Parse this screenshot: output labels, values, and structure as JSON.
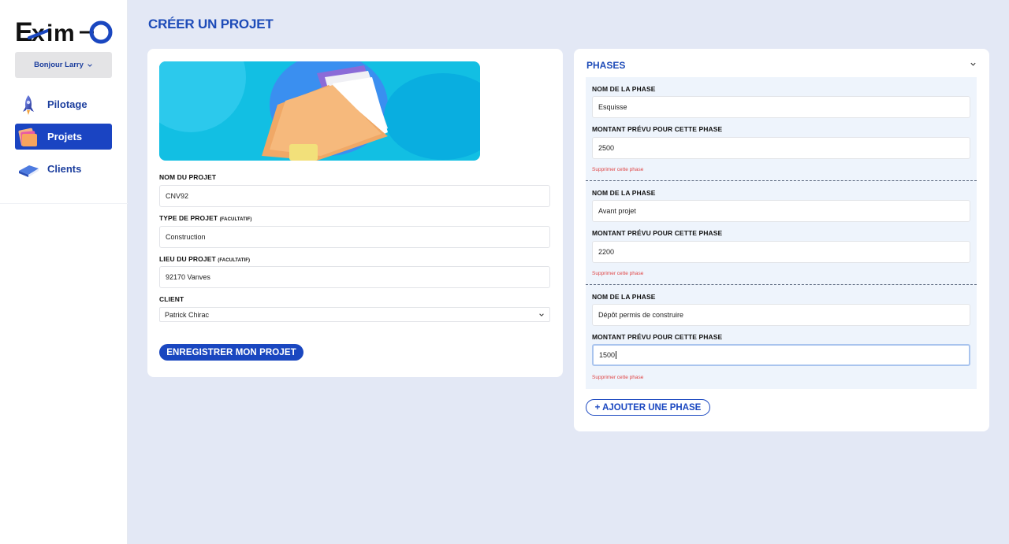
{
  "app": {
    "brand": "Eximo"
  },
  "sidebar": {
    "greeting": "Bonjour Larry",
    "items": [
      {
        "label": "Pilotage",
        "icon": "rocket-icon",
        "active": false
      },
      {
        "label": "Projets",
        "icon": "folder-icon",
        "active": true
      },
      {
        "label": "Clients",
        "icon": "book-icon",
        "active": false
      }
    ]
  },
  "page": {
    "title": "CRÉER UN PROJET"
  },
  "project_form": {
    "name_label": "NOM DU PROJET",
    "name_value": "CNV92",
    "type_label": "TYPE DE PROJET",
    "type_optional": "(FACULTATIF)",
    "type_value": "Construction",
    "location_label": "LIEU DU PROJET",
    "location_optional": "(FACULTATIF)",
    "location_value": "92170 Vanves",
    "client_label": "CLIENT",
    "client_value": "Patrick Chirac",
    "save_label": "ENREGISTRER MON PROJET"
  },
  "phases": {
    "title": "PHASES",
    "items": [
      {
        "name_label": "NOM DE LA PHASE",
        "name_value": "Esquisse",
        "amount_label": "MONTANT PRÉVU POUR CETTE PHASE",
        "amount_value": "2500",
        "delete_label": "Supprimer cette phase"
      },
      {
        "name_label": "NOM DE LA PHASE",
        "name_value": "Avant projet",
        "amount_label": "MONTANT PRÉVU POUR CETTE PHASE",
        "amount_value": "2200",
        "delete_label": "Supprimer cette phase"
      },
      {
        "name_label": "NOM DE LA PHASE",
        "name_value": "Dépôt permis de construire",
        "amount_label": "MONTANT PRÉVU POUR CETTE PHASE",
        "amount_value": "1500",
        "delete_label": "Supprimer cette phase"
      }
    ],
    "add_label": "+ AJOUTER UNE PHASE"
  },
  "colors": {
    "accent": "#1a47c0",
    "title": "#1d4bb8",
    "danger": "#e04646",
    "background": "#e3e8f5"
  }
}
